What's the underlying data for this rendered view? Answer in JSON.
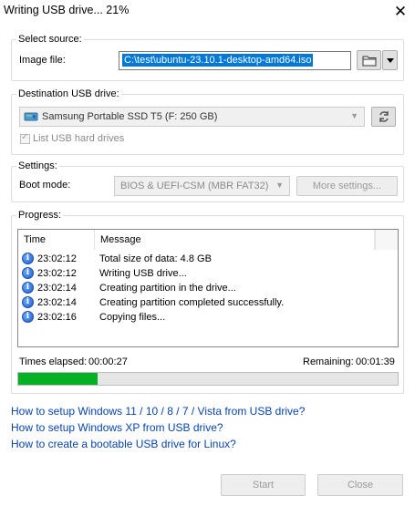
{
  "window": {
    "title": "Writing USB drive... 21%",
    "close_glyph": "✕"
  },
  "source": {
    "legend": "Select source:",
    "image_label": "Image file:",
    "image_path": "C:\\test\\ubuntu-23.10.1-desktop-amd64.iso",
    "browse_icon": "folder-icon",
    "dropdown_icon": "chevron-down-icon"
  },
  "destination": {
    "legend": "Destination USB drive:",
    "drive": "Samsung Portable SSD T5 (F:  250 GB)",
    "refresh_icon": "refresh-icon",
    "list_hdd_label": "List USB hard drives",
    "list_hdd_checked": true
  },
  "settings": {
    "legend": "Settings:",
    "boot_mode_label": "Boot mode:",
    "boot_mode_value": "BIOS & UEFI-CSM (MBR FAT32)",
    "more_settings": "More settings..."
  },
  "progress": {
    "legend": "Progress:",
    "columns": {
      "time": "Time",
      "message": "Message"
    },
    "rows": [
      {
        "time": "23:02:12",
        "message": "Total size of data: 4.8 GB"
      },
      {
        "time": "23:02:12",
        "message": "Writing USB drive..."
      },
      {
        "time": "23:02:14",
        "message": "Creating partition in the drive..."
      },
      {
        "time": "23:02:14",
        "message": "Creating partition completed successfully."
      },
      {
        "time": "23:02:16",
        "message": "Copying files..."
      }
    ],
    "elapsed_label": "Times elapsed:",
    "elapsed_value": "00:00:27",
    "remaining_label": "Remaining:",
    "remaining_value": "00:01:39",
    "percent": 21
  },
  "links": [
    "How to setup Windows 11 / 10 / 8 / 7 / Vista from USB drive?",
    "How to setup Windows XP from USB drive?",
    "How to create a bootable USB drive for Linux?"
  ],
  "footer": {
    "start": "Start",
    "close": "Close"
  },
  "colors": {
    "selection": "#0078d7",
    "progress_fill": "#06b025",
    "link": "#0645ad"
  }
}
